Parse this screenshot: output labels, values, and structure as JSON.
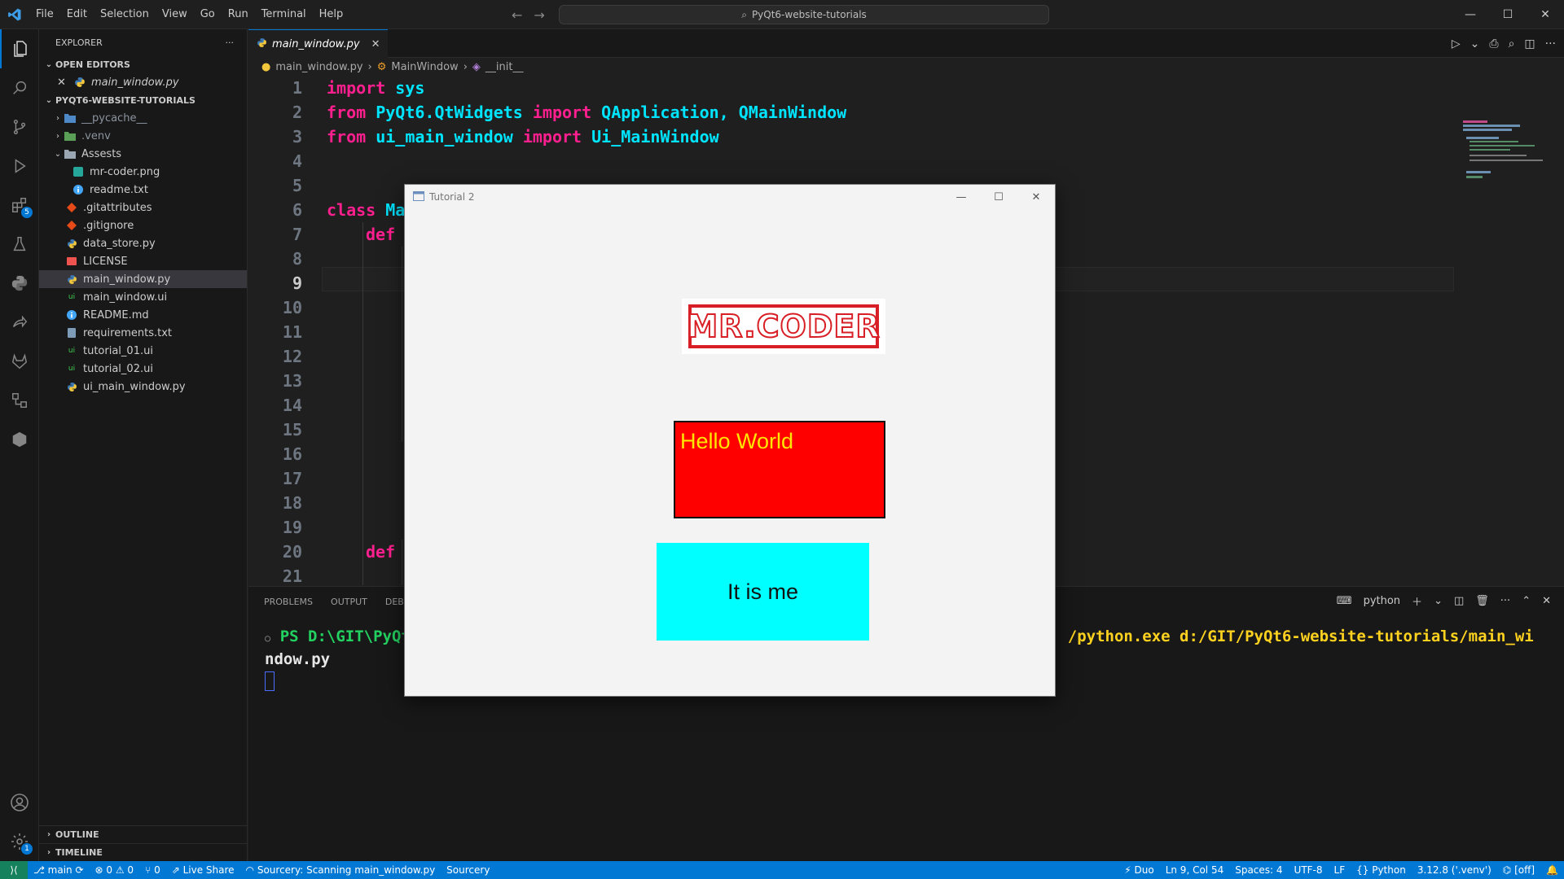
{
  "menu": [
    "File",
    "Edit",
    "Selection",
    "View",
    "Go",
    "Run",
    "Terminal",
    "Help"
  ],
  "search_text": "PyQt6-website-tutorials",
  "explorer": {
    "title": "EXPLORER",
    "open_editors_label": "OPEN EDITORS",
    "open_file": "main_window.py",
    "project_label": "PYQT6-WEBSITE-TUTORIALS",
    "items": [
      {
        "name": "__pycache__",
        "type": "folder"
      },
      {
        "name": ".venv",
        "type": "folder"
      },
      {
        "name": "Assests",
        "type": "folder-open"
      },
      {
        "name": "mr-coder.png",
        "type": "image"
      },
      {
        "name": "readme.txt",
        "type": "info"
      },
      {
        "name": ".gitattributes",
        "type": "git"
      },
      {
        "name": ".gitignore",
        "type": "git"
      },
      {
        "name": "data_store.py",
        "type": "python"
      },
      {
        "name": "LICENSE",
        "type": "license"
      },
      {
        "name": "main_window.py",
        "type": "python"
      },
      {
        "name": "main_window.ui",
        "type": "ui"
      },
      {
        "name": "README.md",
        "type": "info"
      },
      {
        "name": "requirements.txt",
        "type": "req"
      },
      {
        "name": "tutorial_01.ui",
        "type": "ui"
      },
      {
        "name": "tutorial_02.ui",
        "type": "ui"
      },
      {
        "name": "ui_main_window.py",
        "type": "python"
      }
    ],
    "outline_label": "OUTLINE",
    "timeline_label": "TIMELINE"
  },
  "tab": {
    "label": "main_window.py"
  },
  "breadcrumb": [
    "main_window.py",
    "MainWindow",
    "__init__"
  ],
  "code": {
    "line_numbers": [
      "1",
      "2",
      "3",
      "4",
      "5",
      "6",
      "7",
      "8",
      "9",
      "10",
      "11",
      "12",
      "13",
      "14",
      "15",
      "16",
      "17",
      "18",
      "19",
      "20",
      "21"
    ],
    "l1_kw": "import",
    "l1_rest": " sys",
    "l2_kw": "from",
    "l2_mod": " PyQt6.QtWidgets ",
    "l2_kw2": "import",
    "l2_rest": " QApplication, QMainWindow",
    "l3_kw": "from",
    "l3_mod": " ui_main_window ",
    "l3_kw2": "import",
    "l3_rest": " Ui_MainWindow",
    "l6_kw": "class",
    "l6_rest": " Ma",
    "l7_kw": "def",
    "l20_kw": "def"
  },
  "panel": {
    "tabs": [
      "PROBLEMS",
      "OUTPUT",
      "DEBU"
    ],
    "shell": "python",
    "ps_prefix": "PS D:\\GIT\\PyQt",
    "cmd_tail": "/python.exe d:/GIT/PyQt6-website-tutorials/main_wi",
    "cmd_wrap": "ndow.py"
  },
  "qt_window": {
    "title": "Tutorial 2",
    "logo_text": "MR.CODER",
    "hello_text": "Hello World",
    "button_text": "It is me"
  },
  "status": {
    "branch": "main",
    "errors": "0",
    "warnings": "0",
    "ports": "0",
    "live_share": "Live Share",
    "sourcery_scan": "Sourcery: Scanning main_window.py",
    "sourcery": "Sourcery",
    "duo": "Duo",
    "position": "Ln 9, Col 54",
    "spaces": "Spaces: 4",
    "encoding": "UTF-8",
    "eol": "LF",
    "language": "Python",
    "interpreter": "3.12.8 ('.venv')",
    "copilot": "[off]"
  },
  "colors": {
    "accent": "#0078d4",
    "keyword": "#ff1f8f",
    "identifier": "#00e5ff",
    "terminal_prompt": "#23d160",
    "terminal_path": "#ffd21f",
    "hello_bg": "#ff0000",
    "hello_text": "#ffe600",
    "button_bg": "#00ffff"
  }
}
